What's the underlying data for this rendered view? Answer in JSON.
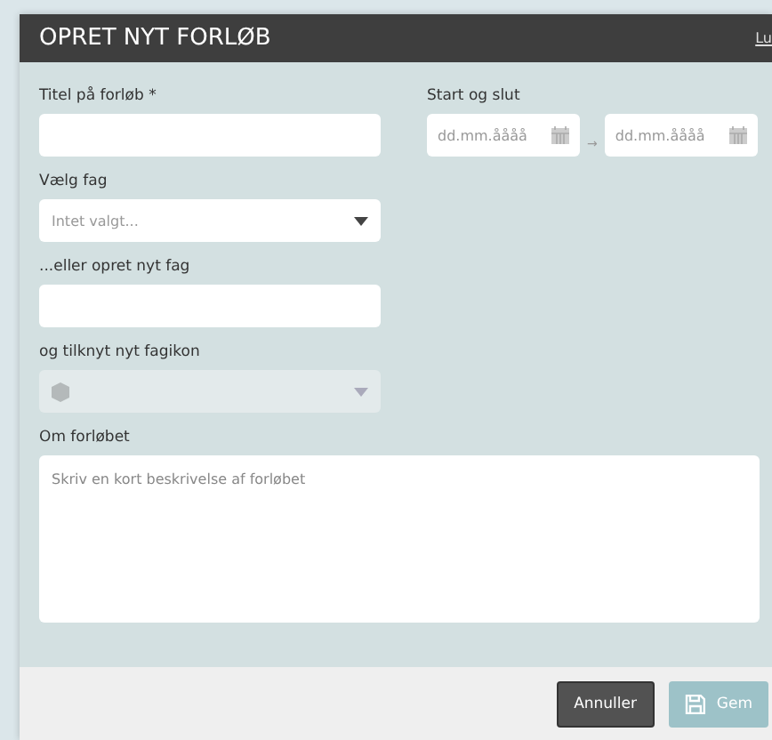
{
  "dialog": {
    "title": "OPRET NYT FORLØB",
    "close_link": "Lu"
  },
  "fields": {
    "title_label": "Titel på forløb *",
    "dates_label": "Start og slut",
    "start_placeholder": "dd.mm.åååå",
    "arrow": "→",
    "end_placeholder": "dd.mm.åååå",
    "subject_label": "Vælg fag",
    "subject_placeholder": "Intet valgt...",
    "new_subject_label": "...eller opret nyt fag",
    "icon_label": "og tilknyt nyt fagikon",
    "icon_disabled": true,
    "about_label": "Om forløbet",
    "about_placeholder": "Skriv en kort beskrivelse af forløbet"
  },
  "buttons": [
    {
      "label": "Annuller",
      "kind": "cancel",
      "disabled": false
    },
    {
      "label": "Gem",
      "kind": "save",
      "disabled": true
    }
  ]
}
